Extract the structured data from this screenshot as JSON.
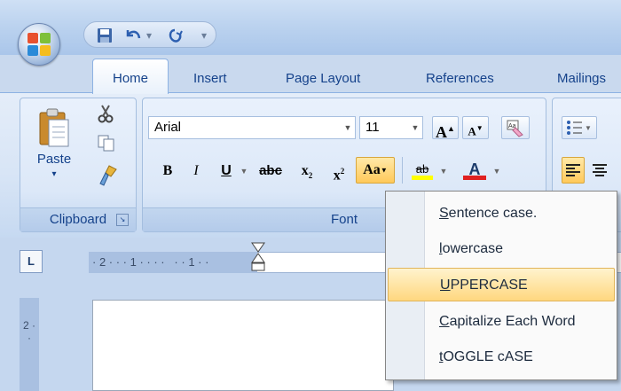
{
  "quick_access": {
    "save_icon": "save-icon",
    "undo_icon": "undo-icon",
    "redo_icon": "redo-icon",
    "customize_icon": "customize-dropdown-icon"
  },
  "tabs": [
    "Home",
    "Insert",
    "Page Layout",
    "References",
    "Mailings"
  ],
  "clipboard": {
    "paste_label": "Paste",
    "group_label": "Clipboard"
  },
  "font": {
    "font_name": "Arial",
    "font_size": "11",
    "bold": "B",
    "italic": "I",
    "underline": "U",
    "strikethrough": "abc",
    "subscript": "x",
    "subscript_mark": "2",
    "superscript": "x",
    "superscript_mark": "2",
    "change_case": "Aa",
    "grow_font": "A",
    "shrink_font": "A",
    "highlight_label": "ab",
    "font_color_label": "A",
    "group_label": "Font",
    "highlight_color": "#ffff00",
    "font_color": "#e02020"
  },
  "ruler": {
    "corner": "L",
    "marks": "· 2 · · · 1 · · · ·   · · 1 · ·",
    "vertical_marks": "2 · ·"
  },
  "change_case_menu": {
    "items": [
      {
        "label": "Sentence case.",
        "underline": "S",
        "rest": "entence case."
      },
      {
        "label": "lowercase",
        "underline": "l",
        "rest": "owercase"
      },
      {
        "label": "UPPERCASE",
        "underline": "U",
        "rest": "PPERCASE",
        "selected": true
      },
      {
        "label": "Capitalize Each Word",
        "underline": "C",
        "rest": "apitalize Each Word"
      },
      {
        "label": "tOGGLE cASE",
        "underline": "t",
        "rest": "OGGLE cASE"
      }
    ]
  },
  "colors": {
    "accent": "#15428b",
    "highlight_hover": "#ffc95a"
  }
}
